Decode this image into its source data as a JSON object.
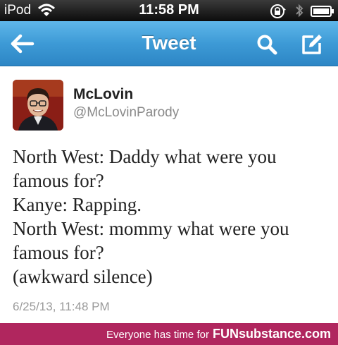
{
  "status_bar": {
    "carrier": "iPod",
    "time": "11:58 PM",
    "icons": [
      "wifi-icon",
      "lock-rotation-icon",
      "bluetooth-icon",
      "battery-icon"
    ]
  },
  "nav": {
    "title": "Tweet",
    "back_icon": "back-arrow-icon",
    "search_icon": "search-icon",
    "compose_icon": "compose-icon",
    "colors": {
      "bar_top": "#5fb7ea",
      "bar_bottom": "#2d86c5"
    }
  },
  "tweet": {
    "display_name": "McLovin",
    "handle": "@McLovinParody",
    "text_lines": [
      "North West: Daddy what were you",
      "famous for?",
      "Kanye: Rapping.",
      "North West: mommy what were you",
      "famous for?",
      "(awkward silence)"
    ],
    "timestamp": "6/25/13, 11:48 PM"
  },
  "footer": {
    "tagline": "Everyone has time for",
    "brand": "FUNsubstance.com",
    "color": "#b0265e"
  }
}
